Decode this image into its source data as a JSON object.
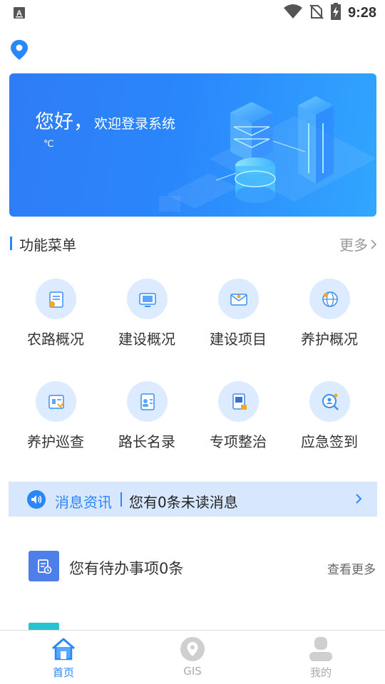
{
  "status_bar": {
    "time": "9:28",
    "icons": [
      "app-notification-icon",
      "wifi-icon",
      "no-sim-icon",
      "battery-charging-icon"
    ]
  },
  "location_icon": "map-pin-icon",
  "banner": {
    "greeting": "您好，",
    "welcome": "欢迎登录系统",
    "temperature": "℃"
  },
  "menu_section": {
    "title": "功能菜单",
    "more": "更多",
    "items": [
      {
        "label": "农路概况",
        "icon": "document-icon"
      },
      {
        "label": "建设概况",
        "icon": "monitor-icon"
      },
      {
        "label": "建设项目",
        "icon": "mail-icon"
      },
      {
        "label": "养护概况",
        "icon": "globe-icon"
      },
      {
        "label": "养护巡查",
        "icon": "id-card-icon"
      },
      {
        "label": "路长名录",
        "icon": "contacts-icon"
      },
      {
        "label": "专项整治",
        "icon": "report-icon"
      },
      {
        "label": "应急签到",
        "icon": "search-person-icon"
      }
    ]
  },
  "news": {
    "title": "消息资讯",
    "message": "您有0条未读消息"
  },
  "todo": {
    "text": "您有待办事项0条",
    "more": "查看更多"
  },
  "tabbar": {
    "tabs": [
      {
        "label": "首页",
        "icon": "home-icon",
        "active": true
      },
      {
        "label": "GIS",
        "icon": "map-pin-icon",
        "active": false
      },
      {
        "label": "我的",
        "icon": "user-icon",
        "active": false
      }
    ]
  },
  "colors": {
    "accent": "#2a86fb",
    "news_bg": "#d7e7fd",
    "icon_circle": "#dcebff"
  }
}
